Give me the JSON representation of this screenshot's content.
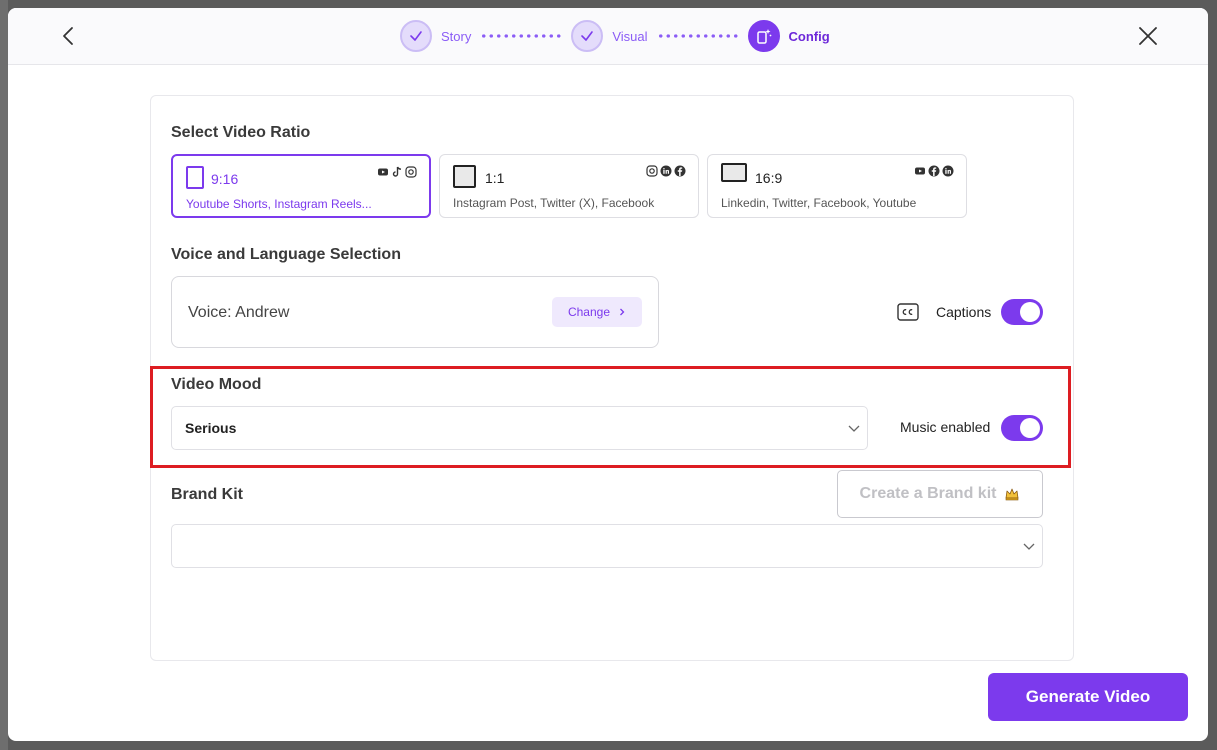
{
  "steps": [
    {
      "label": "Story",
      "state": "done"
    },
    {
      "label": "Visual",
      "state": "done"
    },
    {
      "label": "Config",
      "state": "active"
    }
  ],
  "ratio": {
    "title": "Select Video Ratio",
    "options": [
      {
        "label": "9:16",
        "desc": "Youtube Shorts, Instagram Reels...",
        "selected": true,
        "icons": [
          "youtube-icon",
          "tiktok-icon",
          "instagram-icon"
        ]
      },
      {
        "label": "1:1",
        "desc": "Instagram Post, Twitter (X), Facebook",
        "selected": false,
        "icons": [
          "instagram-icon",
          "linkedin-icon",
          "facebook-icon"
        ]
      },
      {
        "label": "16:9",
        "desc": "Linkedin, Twitter, Facebook, Youtube",
        "selected": false,
        "icons": [
          "youtube-icon",
          "facebook-icon",
          "linkedin-icon"
        ]
      }
    ]
  },
  "voice": {
    "title": "Voice and Language Selection",
    "current": "Voice: Andrew",
    "change_label": "Change",
    "captions_label": "Captions",
    "captions_on": true
  },
  "mood": {
    "title": "Video Mood",
    "value": "Serious",
    "music_label": "Music enabled",
    "music_on": true
  },
  "brand": {
    "title": "Brand Kit",
    "create_label": "Create a Brand kit",
    "value": ""
  },
  "footer": {
    "generate_label": "Generate Video"
  },
  "colors": {
    "accent": "#7c3aed",
    "highlight": "#dd1d22"
  }
}
